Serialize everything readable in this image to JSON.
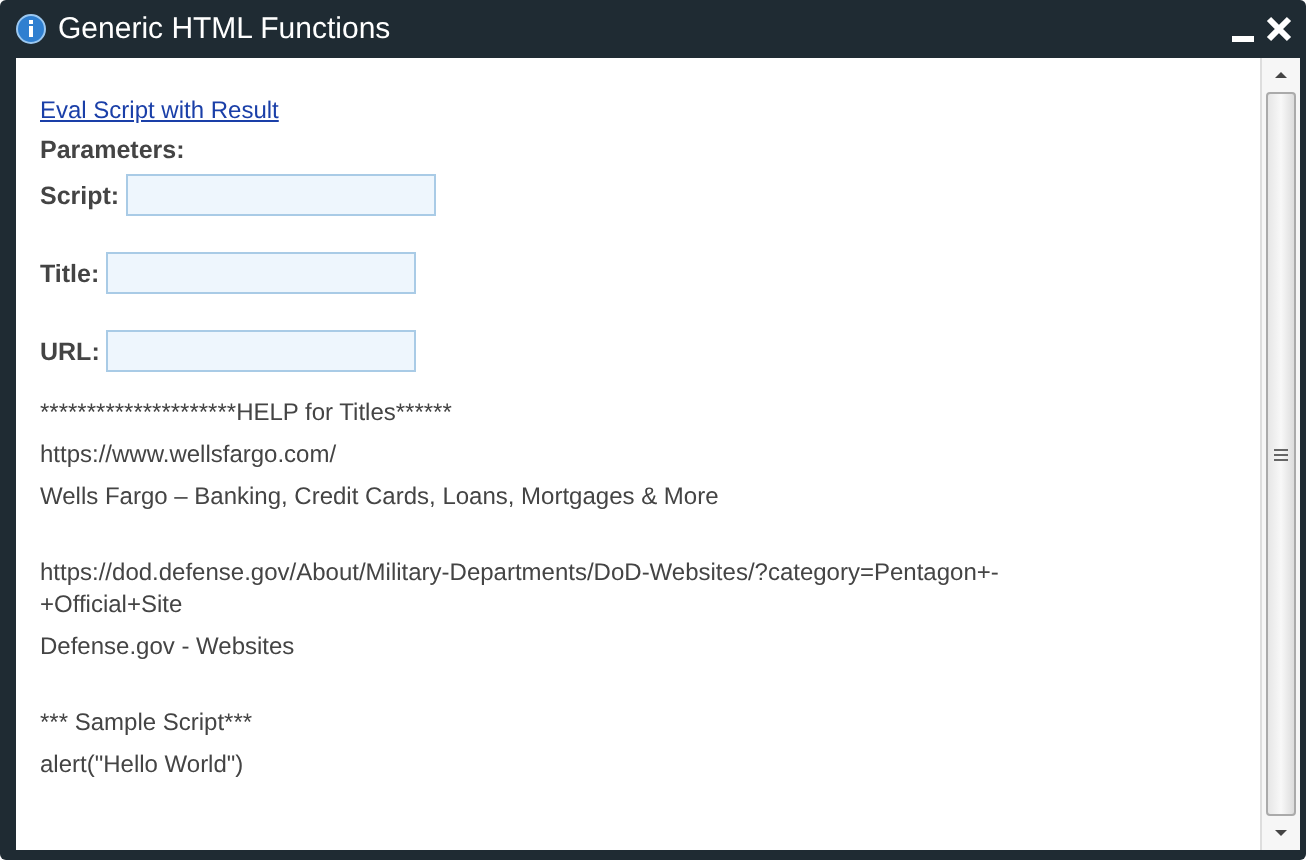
{
  "window": {
    "title": "Generic HTML Functions"
  },
  "link": "Eval Script with Result",
  "parameters_heading": "Parameters:",
  "fields": [
    {
      "label": "Script:"
    },
    {
      "label": "Title:"
    },
    {
      "label": "URL:"
    }
  ],
  "help_groups": [
    [
      "*********************HELP for Titles******",
      "https://www.wellsfargo.com/",
      "Wells Fargo – Banking, Credit Cards, Loans, Mortgages & More"
    ],
    [
      "https://dod.defense.gov/About/Military-Departments/DoD-Websites/?category=Pentagon+-+Official+Site",
      "Defense.gov - Websites"
    ],
    [
      "*** Sample Script***",
      "alert(\"Hello World\")"
    ]
  ]
}
